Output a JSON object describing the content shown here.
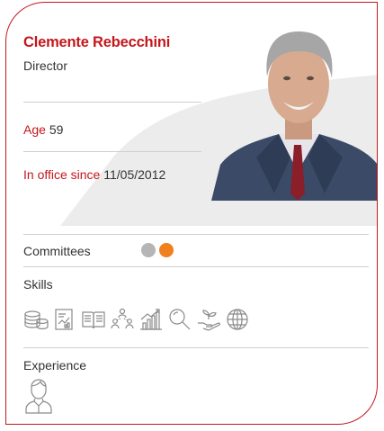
{
  "person": {
    "name": "Clemente Rebecchini",
    "role": "Director",
    "age_label": "Age",
    "age_value": "59",
    "office_label": "In office since",
    "office_value": "11/05/2012"
  },
  "committees": {
    "label": "Committees",
    "dots": [
      {
        "icon": "committee-dot-grey",
        "color": "#b5b5b5"
      },
      {
        "icon": "committee-dot-orange",
        "color": "#f07f1e"
      }
    ]
  },
  "skills": {
    "label": "Skills",
    "icons": [
      "coins-icon",
      "financial-report-icon",
      "open-book-icon",
      "team-network-icon",
      "growth-chart-icon",
      "search-icon",
      "plant-in-hand-icon",
      "globe-icon"
    ]
  },
  "experience": {
    "label": "Experience",
    "icons": [
      "businessman-icon"
    ]
  },
  "colors": {
    "accent": "#c4161c",
    "text": "#333333",
    "divider": "#cfcfcf",
    "icon_stroke": "#8a8a8a"
  }
}
